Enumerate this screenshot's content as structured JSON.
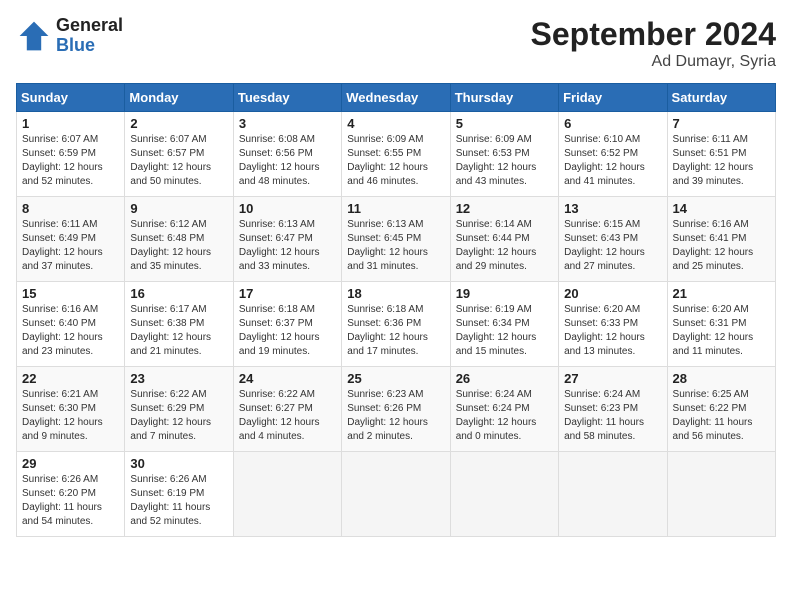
{
  "logo": {
    "general": "General",
    "blue": "Blue"
  },
  "title": {
    "month": "September 2024",
    "location": "Ad Dumayr, Syria"
  },
  "headers": [
    "Sunday",
    "Monday",
    "Tuesday",
    "Wednesday",
    "Thursday",
    "Friday",
    "Saturday"
  ],
  "weeks": [
    [
      {
        "day": "1",
        "sunrise": "6:07 AM",
        "sunset": "6:59 PM",
        "daylight": "12 hours and 52 minutes."
      },
      {
        "day": "2",
        "sunrise": "6:07 AM",
        "sunset": "6:57 PM",
        "daylight": "12 hours and 50 minutes."
      },
      {
        "day": "3",
        "sunrise": "6:08 AM",
        "sunset": "6:56 PM",
        "daylight": "12 hours and 48 minutes."
      },
      {
        "day": "4",
        "sunrise": "6:09 AM",
        "sunset": "6:55 PM",
        "daylight": "12 hours and 46 minutes."
      },
      {
        "day": "5",
        "sunrise": "6:09 AM",
        "sunset": "6:53 PM",
        "daylight": "12 hours and 43 minutes."
      },
      {
        "day": "6",
        "sunrise": "6:10 AM",
        "sunset": "6:52 PM",
        "daylight": "12 hours and 41 minutes."
      },
      {
        "day": "7",
        "sunrise": "6:11 AM",
        "sunset": "6:51 PM",
        "daylight": "12 hours and 39 minutes."
      }
    ],
    [
      {
        "day": "8",
        "sunrise": "6:11 AM",
        "sunset": "6:49 PM",
        "daylight": "12 hours and 37 minutes."
      },
      {
        "day": "9",
        "sunrise": "6:12 AM",
        "sunset": "6:48 PM",
        "daylight": "12 hours and 35 minutes."
      },
      {
        "day": "10",
        "sunrise": "6:13 AM",
        "sunset": "6:47 PM",
        "daylight": "12 hours and 33 minutes."
      },
      {
        "day": "11",
        "sunrise": "6:13 AM",
        "sunset": "6:45 PM",
        "daylight": "12 hours and 31 minutes."
      },
      {
        "day": "12",
        "sunrise": "6:14 AM",
        "sunset": "6:44 PM",
        "daylight": "12 hours and 29 minutes."
      },
      {
        "day": "13",
        "sunrise": "6:15 AM",
        "sunset": "6:43 PM",
        "daylight": "12 hours and 27 minutes."
      },
      {
        "day": "14",
        "sunrise": "6:16 AM",
        "sunset": "6:41 PM",
        "daylight": "12 hours and 25 minutes."
      }
    ],
    [
      {
        "day": "15",
        "sunrise": "6:16 AM",
        "sunset": "6:40 PM",
        "daylight": "12 hours and 23 minutes."
      },
      {
        "day": "16",
        "sunrise": "6:17 AM",
        "sunset": "6:38 PM",
        "daylight": "12 hours and 21 minutes."
      },
      {
        "day": "17",
        "sunrise": "6:18 AM",
        "sunset": "6:37 PM",
        "daylight": "12 hours and 19 minutes."
      },
      {
        "day": "18",
        "sunrise": "6:18 AM",
        "sunset": "6:36 PM",
        "daylight": "12 hours and 17 minutes."
      },
      {
        "day": "19",
        "sunrise": "6:19 AM",
        "sunset": "6:34 PM",
        "daylight": "12 hours and 15 minutes."
      },
      {
        "day": "20",
        "sunrise": "6:20 AM",
        "sunset": "6:33 PM",
        "daylight": "12 hours and 13 minutes."
      },
      {
        "day": "21",
        "sunrise": "6:20 AM",
        "sunset": "6:31 PM",
        "daylight": "12 hours and 11 minutes."
      }
    ],
    [
      {
        "day": "22",
        "sunrise": "6:21 AM",
        "sunset": "6:30 PM",
        "daylight": "12 hours and 9 minutes."
      },
      {
        "day": "23",
        "sunrise": "6:22 AM",
        "sunset": "6:29 PM",
        "daylight": "12 hours and 7 minutes."
      },
      {
        "day": "24",
        "sunrise": "6:22 AM",
        "sunset": "6:27 PM",
        "daylight": "12 hours and 4 minutes."
      },
      {
        "day": "25",
        "sunrise": "6:23 AM",
        "sunset": "6:26 PM",
        "daylight": "12 hours and 2 minutes."
      },
      {
        "day": "26",
        "sunrise": "6:24 AM",
        "sunset": "6:24 PM",
        "daylight": "12 hours and 0 minutes."
      },
      {
        "day": "27",
        "sunrise": "6:24 AM",
        "sunset": "6:23 PM",
        "daylight": "11 hours and 58 minutes."
      },
      {
        "day": "28",
        "sunrise": "6:25 AM",
        "sunset": "6:22 PM",
        "daylight": "11 hours and 56 minutes."
      }
    ],
    [
      {
        "day": "29",
        "sunrise": "6:26 AM",
        "sunset": "6:20 PM",
        "daylight": "11 hours and 54 minutes."
      },
      {
        "day": "30",
        "sunrise": "6:26 AM",
        "sunset": "6:19 PM",
        "daylight": "11 hours and 52 minutes."
      },
      null,
      null,
      null,
      null,
      null
    ]
  ]
}
